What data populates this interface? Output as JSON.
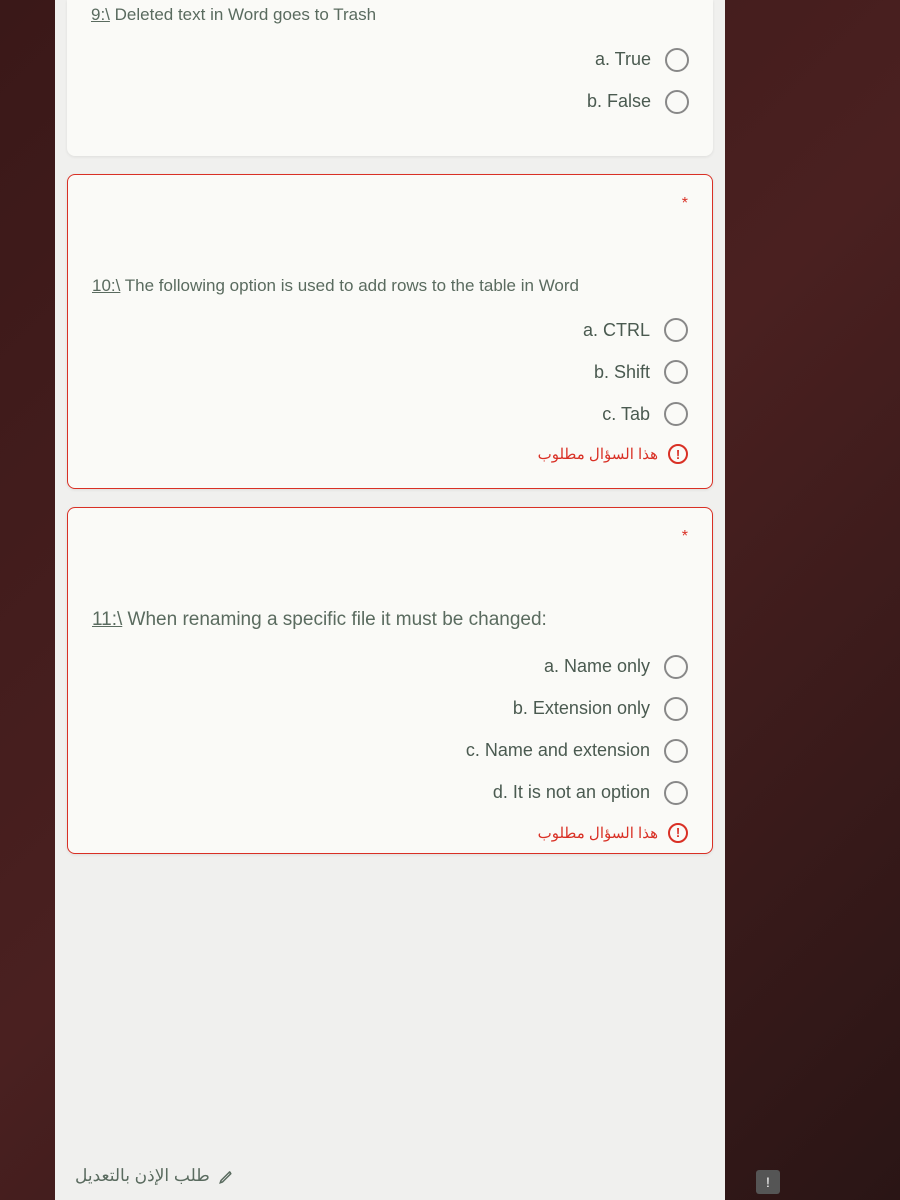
{
  "questions": {
    "q9": {
      "number": "9:\\",
      "text": " Deleted text in Word goes to Trash",
      "options": [
        "a. True",
        "b. False"
      ]
    },
    "q10": {
      "number": "10:\\",
      "text": " The following option is used to add rows to the table in Word",
      "required_mark": "*",
      "options": [
        "a. CTRL",
        "b. Shift",
        "c. Tab"
      ],
      "error_text": "هذا السؤال مطلوب"
    },
    "q11": {
      "number": "11:\\",
      "text": " When renaming a specific file it must be changed:",
      "required_mark": "*",
      "options": [
        "a. Name only",
        "b. Extension only",
        "c. Name and extension",
        "d. It is not an option"
      ],
      "error_text": "هذا السؤال مطلوب"
    }
  },
  "footer": {
    "edit_request": "طلب الإذن بالتعديل"
  },
  "error_icon_glyph": "!"
}
